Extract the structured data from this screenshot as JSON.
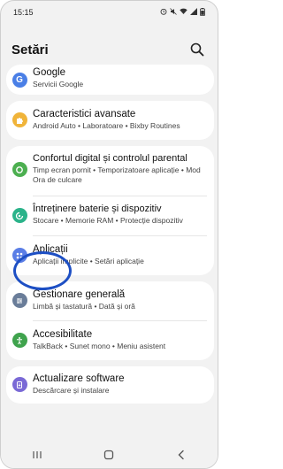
{
  "status_bar": {
    "time": "15:15",
    "icons": [
      "alarm-icon",
      "mute-icon",
      "wifi-icon",
      "signal-icon",
      "battery-icon"
    ]
  },
  "header": {
    "title": "Setări",
    "search_icon": "search-icon"
  },
  "sections": [
    {
      "items": [
        {
          "title": "Google",
          "subtitle": "Servicii Google",
          "icon": "google-icon",
          "color": "#4a7fe6"
        }
      ]
    },
    {
      "items": [
        {
          "title": "Caracteristici avansate",
          "subtitle": "Android Auto  •  Laboratoare  •  Bixby Routines",
          "icon": "puzzle-icon",
          "color": "#f0b43a"
        }
      ]
    },
    {
      "items": [
        {
          "title": "Confortul digital și controlul parental",
          "subtitle": "Timp ecran pornit  •  Temporizatoare aplicație  •  Mod Ora de culcare",
          "icon": "digital-wellbeing-icon",
          "color": "#4caf50"
        },
        {
          "title": "Întreținere baterie și dispozitiv",
          "subtitle": "Stocare  •  Memorie RAM  •  Protecție dispozitiv",
          "icon": "device-care-icon",
          "color": "#2bb38a"
        },
        {
          "title": "Aplicații",
          "subtitle": "Aplicații implicite  •  Setări aplicație",
          "icon": "apps-icon",
          "color": "#5b7ee6"
        }
      ]
    },
    {
      "items": [
        {
          "title": "Gestionare generală",
          "subtitle": "Limbă și tastatură  •  Dată și oră",
          "icon": "sliders-icon",
          "color": "#6a7d99"
        },
        {
          "title": "Accesibilitate",
          "subtitle": "TalkBack  •  Sunet mono  •  Meniu asistent",
          "icon": "accessibility-icon",
          "color": "#3fa34d"
        }
      ]
    },
    {
      "items": [
        {
          "title": "Actualizare software",
          "subtitle": "Descărcare și instalare",
          "icon": "software-update-icon",
          "color": "#7a69d6"
        }
      ]
    }
  ],
  "nav_bar": {
    "buttons": [
      "recent-apps-icon",
      "home-icon",
      "back-icon"
    ]
  }
}
